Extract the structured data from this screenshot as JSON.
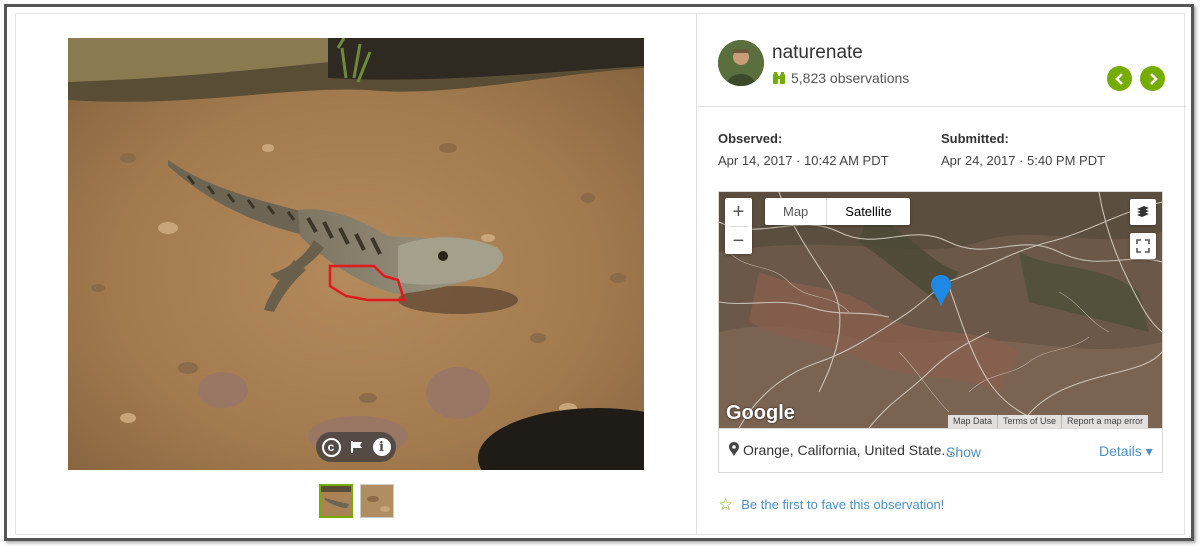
{
  "user": {
    "name": "naturenate",
    "observations": "5,823 observations"
  },
  "nav": {
    "prev_icon": "chevron-left-icon",
    "next_icon": "chevron-right-icon"
  },
  "observed": {
    "label": "Observed:",
    "value": "Apr 14, 2017 · 10:42 AM PDT"
  },
  "submitted": {
    "label": "Submitted:",
    "value": "Apr 24, 2017 · 5:40 PM PDT"
  },
  "map": {
    "zoom_in": "+",
    "zoom_out": "−",
    "type_options": [
      "Map",
      "Satellite"
    ],
    "selected_type": "Satellite",
    "google_logo": "Google",
    "footer": [
      "Map Data",
      "Terms of Use",
      "Report a map error"
    ]
  },
  "location": {
    "place": "Orange, California, United State...",
    "show_label": "Show",
    "details_label": "Details ▾"
  },
  "photo": {
    "controls": [
      "copyright-icon",
      "flag-icon",
      "info-icon"
    ]
  },
  "fave": {
    "label": "Be the first to fave this observation!"
  },
  "colors": {
    "accent": "#74ac00",
    "link": "#4a90c2",
    "highlight": "#e0191f"
  }
}
